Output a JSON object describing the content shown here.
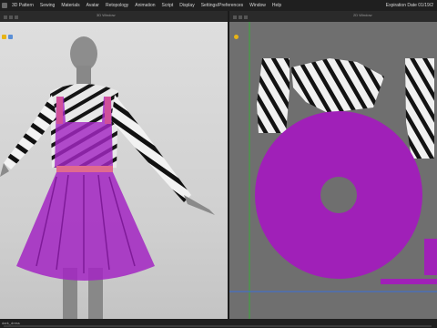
{
  "menu": {
    "items": [
      "3D Pattern",
      "Sewing",
      "Materials",
      "Avatar",
      "Retopology",
      "Animation",
      "Script",
      "Display",
      "Settings/Preferences",
      "Window",
      "Help"
    ],
    "expiration": "Expiration Date 01/19/2"
  },
  "panels": {
    "left_title": "3D Window",
    "right_title": "2D Window"
  },
  "status": {
    "file": "dark_dress"
  },
  "colors": {
    "garment_purple": "#a327c3",
    "pattern_purple": "#a020b8",
    "waistband_pink": "#e06a8f",
    "avatar_gray": "#8c8c8c",
    "grid_bg": "#6f6f6f"
  }
}
